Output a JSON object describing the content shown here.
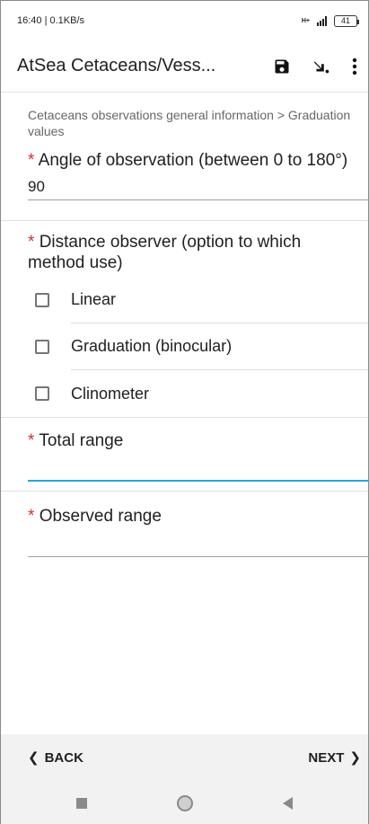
{
  "status_bar": {
    "time_speed": "16:40 | 0.1KB/s",
    "network": "H+",
    "battery": "41"
  },
  "app_bar": {
    "title": "AtSea Cetaceans/Vess..."
  },
  "form": {
    "breadcrumb": "Cetaceans observations general information > Graduation values",
    "required_mark": "*",
    "angle": {
      "label": "Angle of observation (between 0 to 180°)",
      "value": "90"
    },
    "distance": {
      "label": "Distance observer (option to which method use)",
      "options": [
        {
          "label": "Linear",
          "checked": false
        },
        {
          "label": "Graduation (binocular)",
          "checked": false
        },
        {
          "label": "Clinometer",
          "checked": false
        }
      ]
    },
    "total_range": {
      "label": "Total range",
      "value": ""
    },
    "observed_range": {
      "label": "Observed range",
      "value": ""
    }
  },
  "navigation": {
    "back_label": "BACK",
    "next_label": "NEXT"
  },
  "colors": {
    "required": "#d32f2f",
    "focused_underline": "#29a5d6",
    "nav_bg": "#f2f2f2"
  }
}
